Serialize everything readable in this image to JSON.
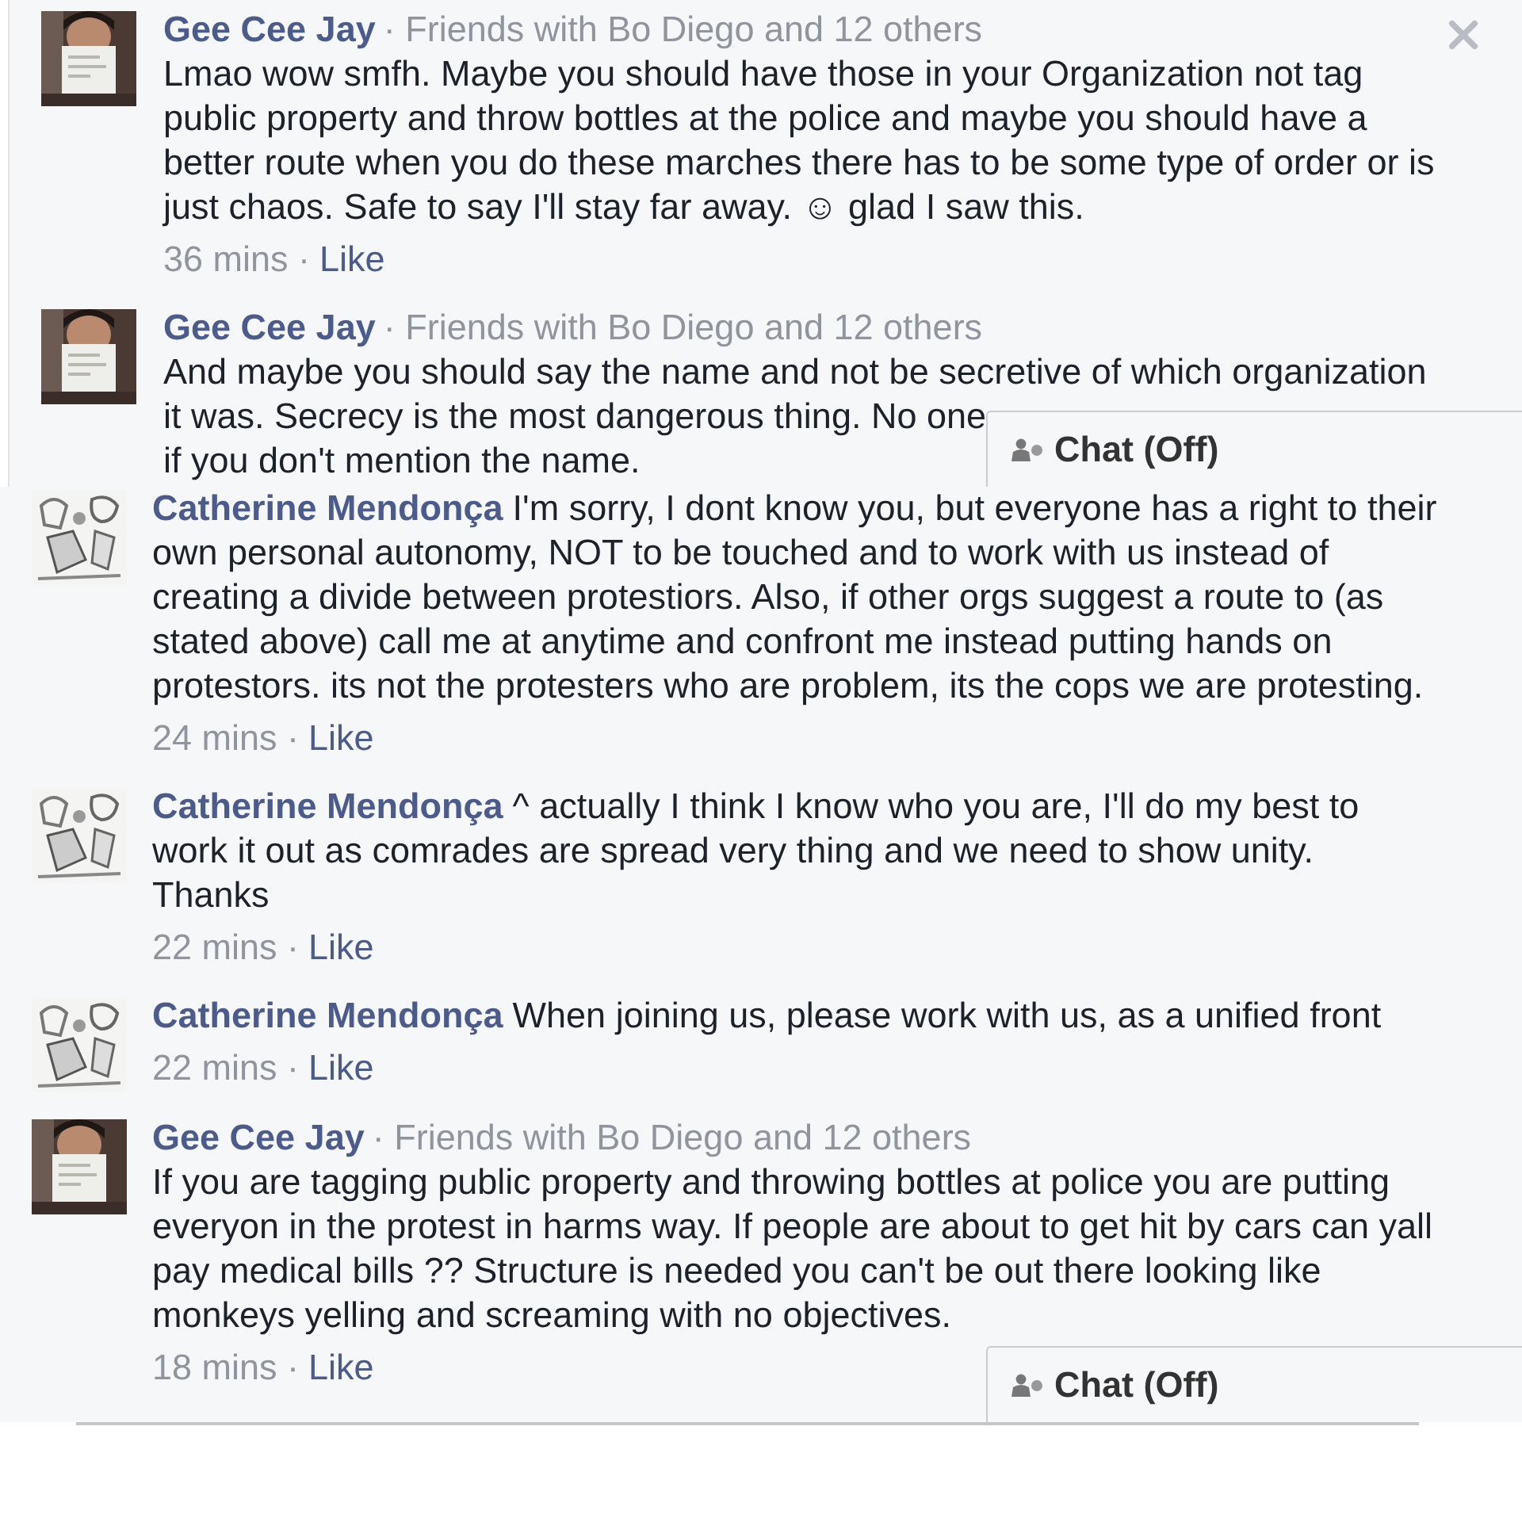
{
  "panels": [
    {
      "closable": true,
      "chat": {
        "label": "Chat (Off)"
      },
      "comments": [
        {
          "author": "Gee Cee Jay",
          "context": "· Friends with Bo Diego and 12 others",
          "lines": [
            "Lmao wow smfh. Maybe you should have those in your Organization not tag",
            "public property and throw bottles at the police and maybe you should have a",
            "better route when you do these marches there has to be some type of order or is",
            "just chaos. Safe to say I'll stay far away. ☺ glad I saw this."
          ],
          "time": "36 mins ·",
          "action": "Like"
        },
        {
          "author": "Gee Cee Jay",
          "context": "· Friends with Bo Diego and 12 others",
          "lines": [
            "And maybe you should say the name and not be secretive of which organization",
            "it was. Secrecy is the most dangerous thing. No one",
            "if you don't mention the name."
          ]
        }
      ]
    },
    {
      "closable": false,
      "chat": {
        "label": "Chat (Off)"
      },
      "comments": [
        {
          "author": "Catherine Mendonça",
          "lines": [
            "I'm sorry, I dont know you, but everyone has a right to their",
            "own personal autonomy, NOT to be touched and to work with us instead of",
            "creating a divide between protestiors. Also, if other orgs suggest a route to (as",
            "stated above) call me at anytime and confront me instead putting hands on",
            "protestors. its not the protesters who are problem, its the cops we are protesting."
          ],
          "time": "24 mins ·",
          "action": "Like"
        },
        {
          "author": "Catherine Mendonça",
          "lines": [
            "^ actually I think I know who you are, I'll do my best to",
            "work it out as comrades are spread very thing and we need to show unity.",
            "Thanks"
          ],
          "time": "22 mins ·",
          "action": "Like"
        },
        {
          "author": "Catherine Mendonça",
          "lines": [
            "When joining us, please work with us, as a unified front"
          ],
          "time": "22 mins ·",
          "action": "Like"
        },
        {
          "author": "Gee Cee Jay",
          "context": "· Friends with Bo Diego and 12 others",
          "lines": [
            "If you are tagging public property and throwing bottles at police you are putting",
            "everyon in the protest in harms way. If people are about to get hit by cars can yall",
            "pay medical bills ?? Structure is needed you can't be out there looking like",
            "monkeys yelling and screaming with no objectives."
          ],
          "time": "18 mins ·",
          "action": "Like"
        }
      ]
    }
  ]
}
